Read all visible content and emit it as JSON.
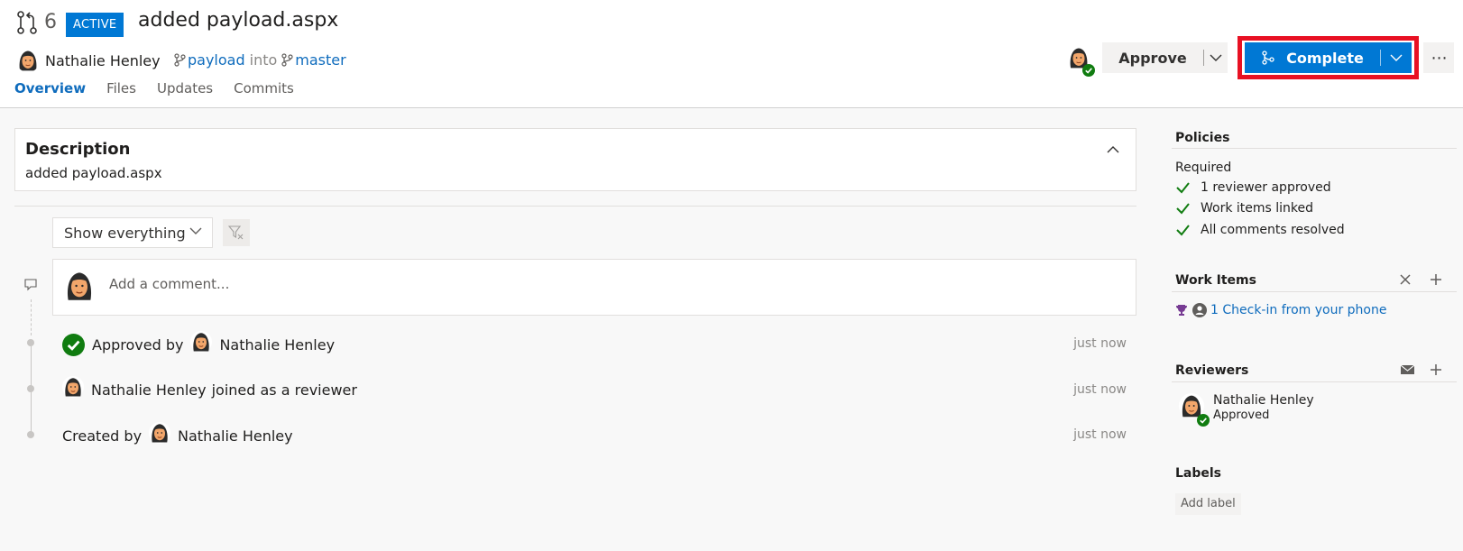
{
  "pr": {
    "id": "6",
    "status": "ACTIVE",
    "title": "added payload.aspx",
    "author": "Nathalie Henley",
    "source_branch": "payload",
    "into": "into",
    "target_branch": "master"
  },
  "tabs": [
    {
      "label": "Overview",
      "active": true
    },
    {
      "label": "Files",
      "active": false
    },
    {
      "label": "Updates",
      "active": false
    },
    {
      "label": "Commits",
      "active": false
    }
  ],
  "actions": {
    "approve_label": "Approve",
    "complete_label": "Complete",
    "more_label": "⋯"
  },
  "description": {
    "title": "Description",
    "body": "added payload.aspx"
  },
  "filter": {
    "selected": "Show everything"
  },
  "comment": {
    "placeholder": "Add a comment..."
  },
  "timeline": [
    {
      "prefix": "Approved by",
      "user": "Nathalie Henley",
      "suffix": "",
      "time": "just now"
    },
    {
      "prefix": "",
      "user": "Nathalie Henley",
      "suffix": "joined as a reviewer",
      "time": "just now"
    },
    {
      "prefix": "Created by",
      "user": "Nathalie Henley",
      "suffix": "",
      "time": "just now"
    }
  ],
  "sidebar": {
    "policies": {
      "title": "Policies",
      "required_label": "Required",
      "items": [
        "1 reviewer approved",
        "Work items linked",
        "All comments resolved"
      ]
    },
    "work_items": {
      "title": "Work Items",
      "link": "1 Check-in from your phone"
    },
    "reviewers": {
      "title": "Reviewers",
      "name": "Nathalie Henley",
      "status": "Approved"
    },
    "labels": {
      "title": "Labels",
      "add_label": "Add label"
    }
  },
  "colors": {
    "accent": "#0078d4",
    "link": "#0f6cbd",
    "success": "#107c10",
    "highlight_frame": "#e81123"
  },
  "icons": [
    "pull-request-icon",
    "branch-icon",
    "check-icon",
    "chevron-down-icon",
    "chevron-up-icon",
    "merge-icon",
    "more-icon",
    "filter-icon",
    "comment-icon",
    "close-icon",
    "plus-icon",
    "mail-icon",
    "trophy-icon",
    "avatar"
  ]
}
